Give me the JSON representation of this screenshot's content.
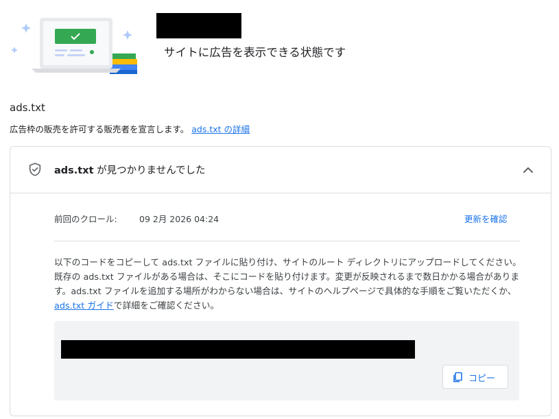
{
  "header": {
    "status_text": "サイトに広告を表示できる状態です"
  },
  "section": {
    "title": "ads.txt",
    "description": "広告枠の販売を許可する販売者を宣言します。",
    "details_link": "ads.txt の詳細"
  },
  "card": {
    "title_bold": "ads.txt",
    "title_rest": " が見つかりませんでした",
    "last_crawl_label": "前回のクロール:",
    "last_crawl_value": "09 2月 2026 04:24",
    "refresh_link": "更新を確認",
    "instructions_before_link": "以下のコードをコピーして ads.txt ファイルに貼り付け、サイトのルート ディレクトリにアップロードしてください。既存の ads.txt ファイルがある場合は、そこにコードを貼り付けます。変更が反映されるまで数日かかる場合があります。ads.txt ファイルを追加する場所がわからない場合は、サイトのヘルプページで具体的な手順をご覧いただくか、",
    "instructions_link": "ads.txt ガイド",
    "instructions_after_link": "で詳細をご確認ください。",
    "copy_button": "コピー"
  },
  "colors": {
    "link": "#1a73e8",
    "text": "#202124",
    "border": "#dadce0",
    "code_bg": "#f1f3f4"
  },
  "icons": {
    "status": "shield-check-icon",
    "collapse": "chevron-up-icon",
    "copy": "copy-icon",
    "illustration": "laptop-illustration"
  }
}
